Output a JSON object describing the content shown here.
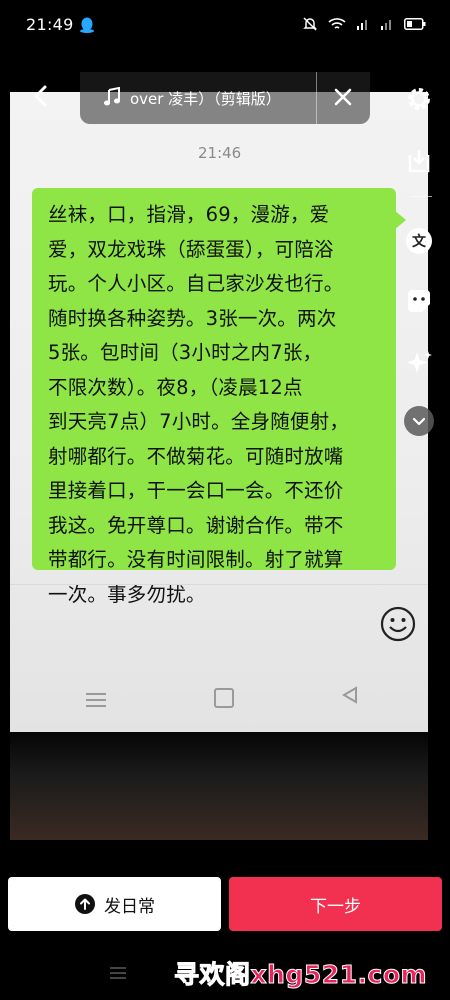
{
  "status_bar": {
    "time": "21:49",
    "icons": [
      "qq-penguin-icon",
      "mute-bell-icon",
      "wifi-icon",
      "signal-icon",
      "signal-icon",
      "battery-icon"
    ]
  },
  "overlay": {
    "music_label": "over 凌丰）（剪辑版）",
    "icons": [
      "back-arrow-icon",
      "music-note-icon",
      "close-icon",
      "settings-gear-icon",
      "download-icon",
      "text-icon",
      "sticker-icon",
      "sparkle-effects-icon",
      "chevron-down-icon"
    ]
  },
  "photo": {
    "chat_time": "21:46",
    "bubble_text": "丝袜，口，指滑，69，漫游，爱\n爱，双龙戏珠（舔蛋蛋），可陪浴\n玩。个人小区。自己家沙发也行。\n随时换各种姿势。3张一次。两次\n5张。包时间（3小时之内7张，\n不限次数）。夜8，（凌晨12点\n到天亮7点）7小时。全身随便射，\n射哪都行。不做菊花。可随时放嘴\n里接着口，干一会口一会。不还价\n我这。免开尊口。谢谢合作。带不\n带都行。没有时间限制。射了就算\n一次。事多勿扰。",
    "bubble_color": "#8ee545"
  },
  "actions": {
    "daily_label": "发日常",
    "next_label": "下一步",
    "next_color": "#f2304f"
  },
  "watermark": "寻欢阁xhg521.com"
}
